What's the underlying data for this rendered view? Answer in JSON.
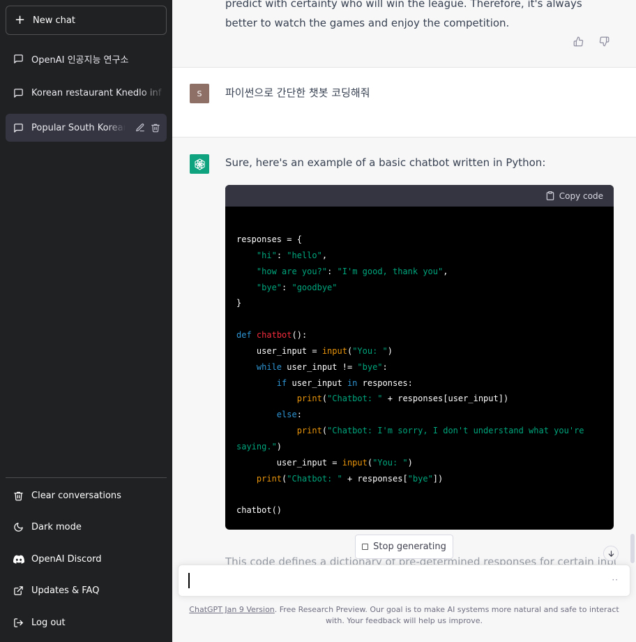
{
  "sidebar": {
    "new_chat": "New chat",
    "conversations": [
      {
        "title": "OpenAI 인공지능 연구소"
      },
      {
        "title": "Korean restaurant Knedlo inf"
      },
      {
        "title": "Popular South Korean"
      }
    ],
    "bottom": {
      "clear": "Clear conversations",
      "dark_mode": "Dark mode",
      "discord": "OpenAI Discord",
      "updates": "Updates & FAQ",
      "logout": "Log out"
    }
  },
  "thread": {
    "prev_text": "predict with certainty who will win the league. Therefore, it's always better to watch the games and enjoy the competition.",
    "user_avatar": "S",
    "user_message": "파이썬으로 간단한 챗봇 코딩해줘",
    "assistant_intro": "Sure, here's an example of a basic chatbot written in Python:",
    "copy_code": "Copy code",
    "faded_text": "This code defines a dictionary of pre-determined responses for certain inputs"
  },
  "controls": {
    "stop_generating": "Stop generating"
  },
  "footer": {
    "version_link": "ChatGPT Jan 9 Version",
    "text": ". Free Research Preview. Our goal is to make AI systems more natural and safe to interact with. Your feedback will help us improve."
  },
  "colors": {
    "sidebar_bg": "#202123",
    "assistant_bg": "#f7f7f8",
    "gpt_green": "#10a37f",
    "code_bg": "#000000"
  }
}
